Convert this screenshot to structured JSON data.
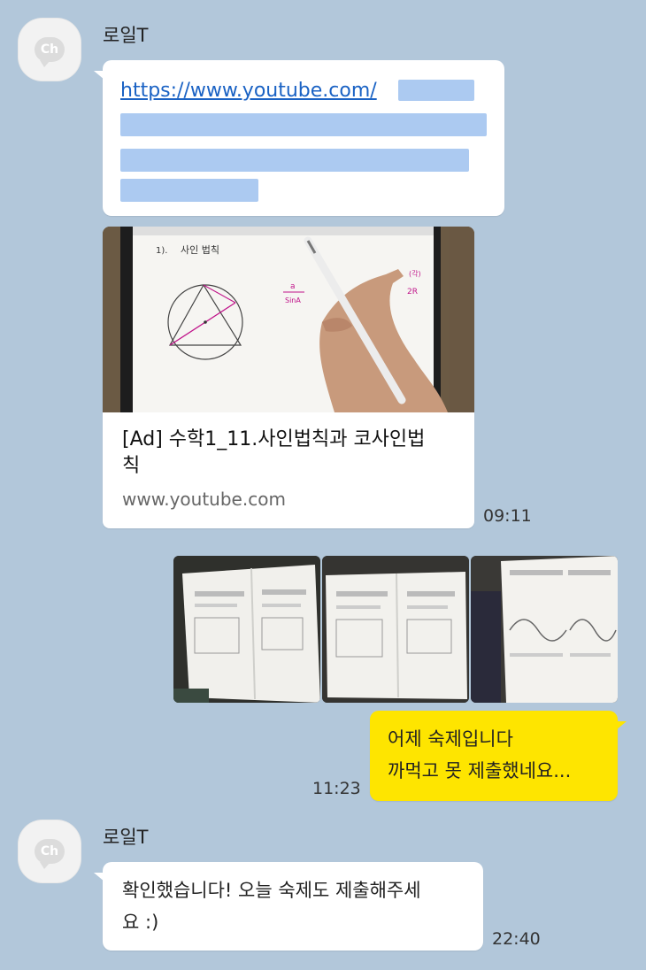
{
  "chat": {
    "messages": [
      {
        "sender": "로일T",
        "link_text": "https://www.youtube.com/",
        "preview": {
          "title": "[Ad] 수학1_11.사인법칙과 코사인법칙",
          "title_line1": "[Ad] 수학1_11.사인법칙과 코사인법",
          "title_line2": "칙",
          "domain": "www.youtube.com",
          "video_heading": "사인 법칙"
        },
        "time": "09:11"
      },
      {
        "sender": "me",
        "photos": [
          "homework-photo-1",
          "homework-photo-2",
          "homework-photo-3"
        ],
        "text_line1": "어제 숙제입니다",
        "text_line2": "까먹고 못 제출했네요...",
        "time": "11:23"
      },
      {
        "sender": "로일T",
        "text_line1": "확인했습니다! 오늘 숙제도 제출해주세",
        "text_line2": "요 :)",
        "time": "22:40"
      }
    ]
  },
  "avatar_label": "Ch",
  "colors": {
    "background": "#b2c7da",
    "my_bubble": "#fee500",
    "their_bubble": "#ffffff",
    "link": "#1a62c4"
  },
  "icons": [
    "channel-avatar-icon"
  ]
}
